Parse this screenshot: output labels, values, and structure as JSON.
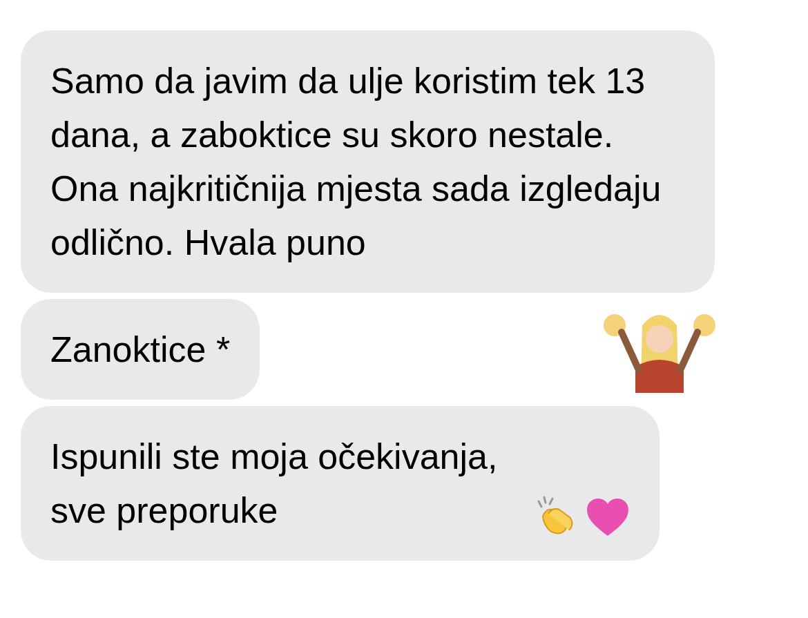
{
  "messages": [
    {
      "text": "Samo da javim da ulje koristim tek 13 dana, a zaboktice su skoro nestale. Ona najkritičnija mjesta sada izgledaju odlično. Hvala puno",
      "kind": "plain"
    },
    {
      "text": "Zanoktice *",
      "kind": "sticker"
    },
    {
      "text": "Ispunili ste moja očekivanja, sve preporuke",
      "kind": "emoji"
    }
  ]
}
